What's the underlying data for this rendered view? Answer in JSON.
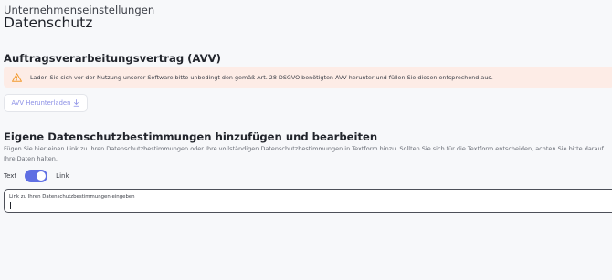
{
  "header": {
    "breadcrumb": "Unternehmenseinstellungen",
    "title": "Datenschutz"
  },
  "avv": {
    "heading": "Auftragsverarbeitungsvertrag (AVV)",
    "warning_icon": "warning-triangle-icon",
    "warning_text": "Laden Sie sich vor der Nutzung unserer Software bitte unbedingt den gemäß Art. 28 DSGVO benötigten AVV herunter und füllen Sie diesen entsprechend aus.",
    "download_label": "AVV Herunterladen",
    "download_icon": "download-arrow-icon"
  },
  "privacy": {
    "heading": "Eigene Datenschutzbestimmungen hinzufügen und bearbeiten",
    "description": "Fügen Sie hier einen Link zu Ihren Datenschutzbestimmungen oder Ihre vollständigen Datenschutzbestimmungen in Textform hinzu. Sollten Sie sich für die Textform entscheiden, achten Sie bitte darauf Ihre Daten halten.",
    "toggle": {
      "left_label": "Text",
      "right_label": "Link",
      "state": "Link"
    },
    "link_field": {
      "label": "Link zu Ihren Datenschutzbestimmungen eingeben",
      "value": "",
      "placeholder": ""
    }
  },
  "colors": {
    "accent": "#5f6fe3",
    "warning_bg": "#fdece6",
    "warning_icon": "#f29a2e",
    "link_text": "#8b8fe6"
  }
}
